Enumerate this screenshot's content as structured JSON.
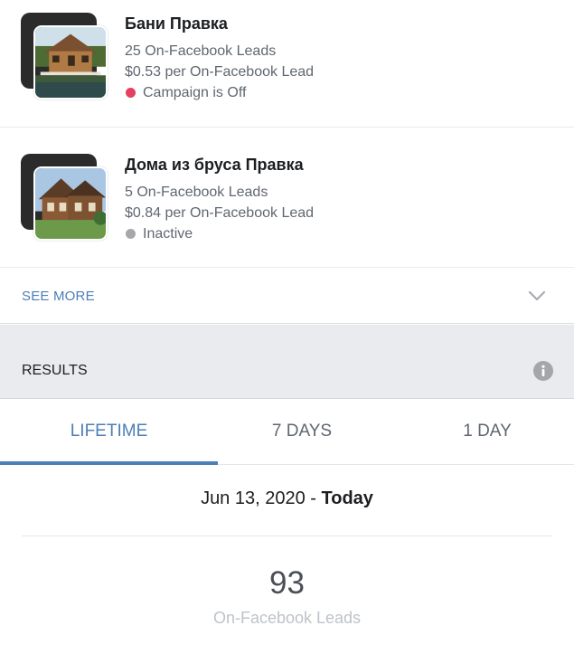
{
  "campaigns": [
    {
      "title": "Бани Правка",
      "leads": "25 On-Facebook Leads",
      "cost": "$0.53 per On-Facebook Lead",
      "status": "Campaign is Off",
      "status_color": "#e4405f",
      "thumbnail": "wooden-bathhouse-photo"
    },
    {
      "title": "Дома из бруса Правка",
      "leads": "5 On-Facebook Leads",
      "cost": "$0.84 per On-Facebook Lead",
      "status": "Inactive",
      "status_color": "#a5a7aa",
      "thumbnail": "timber-house-photo"
    }
  ],
  "see_more": {
    "label": "SEE MORE",
    "icon": "chevron-down-icon"
  },
  "results": {
    "title": "RESULTS",
    "icon": "info-icon"
  },
  "tabs": [
    {
      "label": "LIFETIME",
      "active": true
    },
    {
      "label": "7 DAYS",
      "active": false
    },
    {
      "label": "1 DAY",
      "active": false
    }
  ],
  "date_range": {
    "start": "Jun 13, 2020 - ",
    "end": "Today"
  },
  "metric": {
    "value": "93",
    "label": "On-Facebook Leads"
  },
  "colors": {
    "accent": "#4b7fb6",
    "section_bg": "#e9ebee"
  }
}
